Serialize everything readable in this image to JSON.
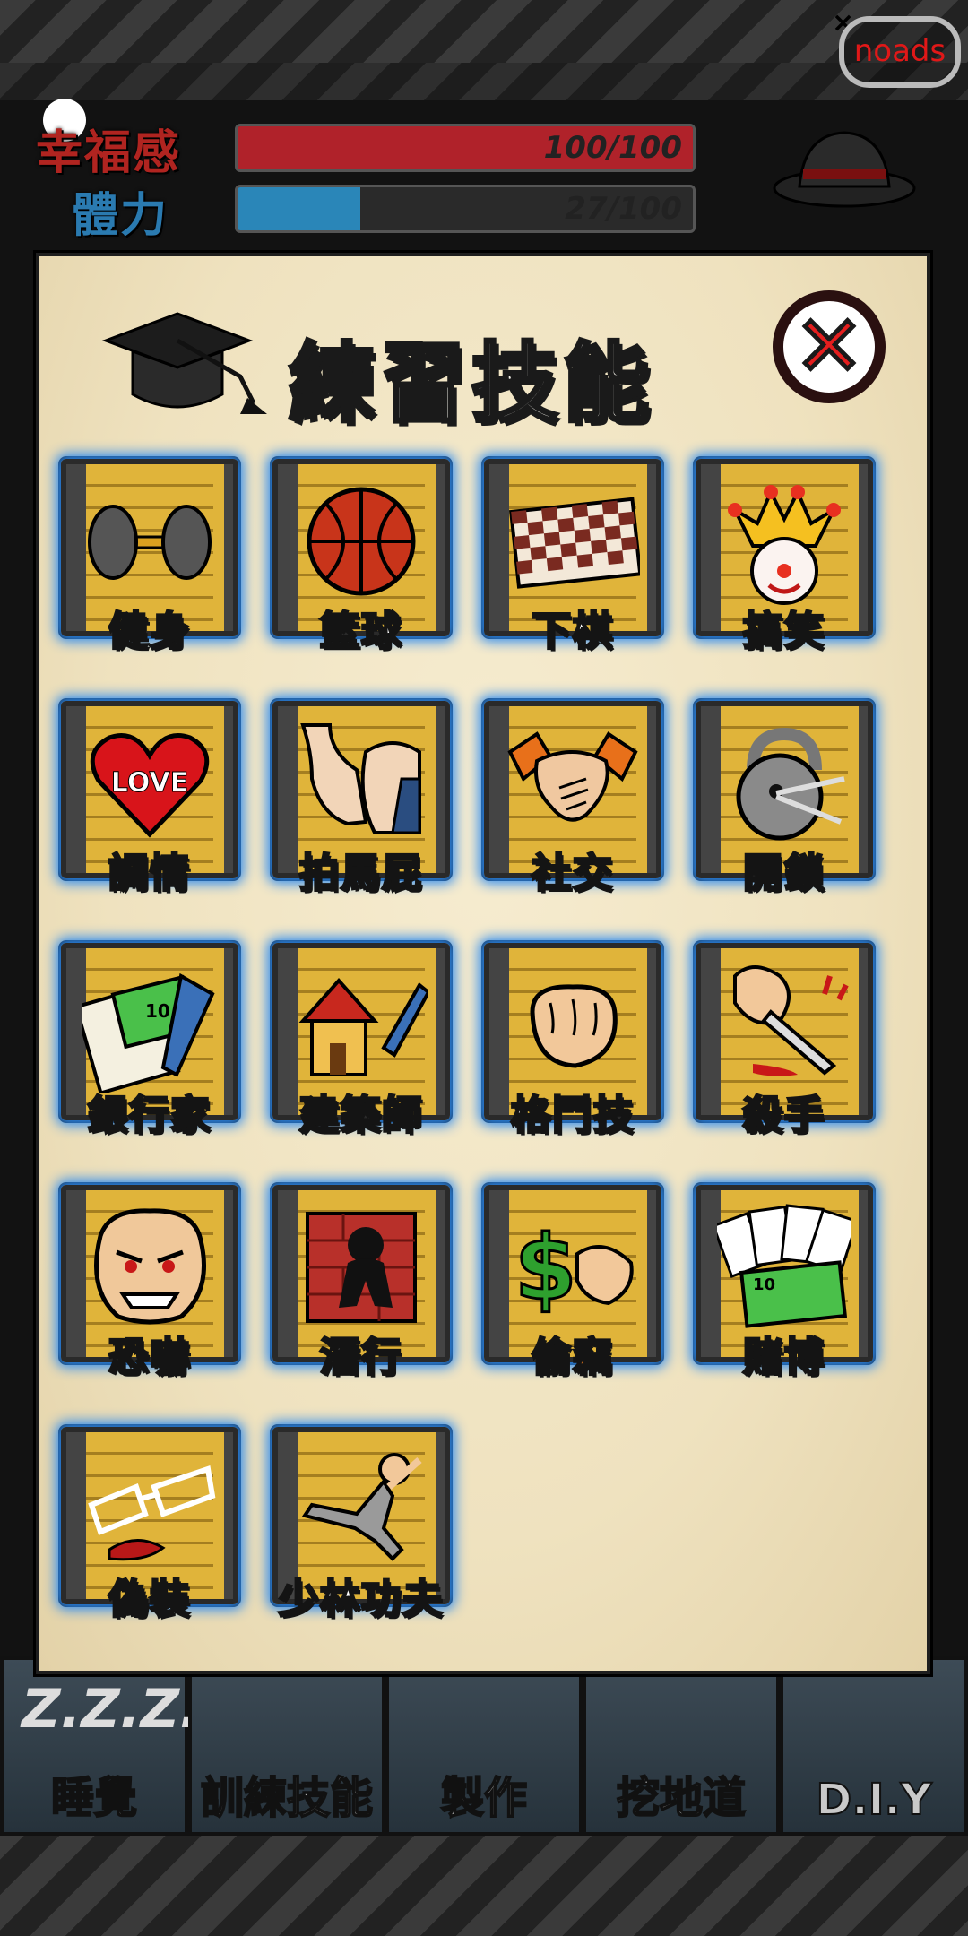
{
  "hud": {
    "stats": [
      {
        "label": "幸福感",
        "value": "100/100",
        "fill_ratio": 1.0,
        "color": "#b0222a"
      },
      {
        "label": "體力",
        "value": "27/100",
        "fill_ratio": 0.27,
        "color": "#2a86b8"
      }
    ],
    "noads_label": "noads",
    "close_glyph": "×"
  },
  "dialog": {
    "title": "練習技能",
    "close_glyph": "✕",
    "skills": [
      {
        "label": "健身",
        "icon": "dumbbell-icon"
      },
      {
        "label": "籃球",
        "icon": "basketball-icon"
      },
      {
        "label": "下棋",
        "icon": "chessboard-icon"
      },
      {
        "label": "搞笑",
        "icon": "clown-icon"
      },
      {
        "label": "調情",
        "icon": "heart-icon",
        "icon_text": "LOVE"
      },
      {
        "label": "拍馬屁",
        "icon": "kiss-butt-icon"
      },
      {
        "label": "社交",
        "icon": "handshake-icon"
      },
      {
        "label": "開鎖",
        "icon": "lock-pick-icon"
      },
      {
        "label": "銀行家",
        "icon": "money-notebook-icon",
        "icon_text": "10"
      },
      {
        "label": "建築師",
        "icon": "house-pencil-icon"
      },
      {
        "label": "格鬥技",
        "icon": "fist-icon"
      },
      {
        "label": "殺手",
        "icon": "knife-hand-icon"
      },
      {
        "label": "恐嚇",
        "icon": "angry-face-icon"
      },
      {
        "label": "潛行",
        "icon": "ninja-icon"
      },
      {
        "label": "偷竊",
        "icon": "steal-money-icon",
        "highlight": true
      },
      {
        "label": "賭博",
        "icon": "cards-money-icon",
        "icon_text": "10"
      },
      {
        "label": "偽裝",
        "icon": "disguise-glasses-icon"
      },
      {
        "label": "少林功夫",
        "icon": "kungfu-kick-icon"
      }
    ]
  },
  "bottom_bar": [
    {
      "label": "睡覺",
      "icon_text": "Z.Z.Z..."
    },
    {
      "label": "訓練技能",
      "icon": "grad-cap-icon"
    },
    {
      "label": "製作",
      "icon": "tools-icon"
    },
    {
      "label": "挖地道",
      "icon": "dig-icon"
    },
    {
      "label": "D.I.Y",
      "icon": "book-icon"
    }
  ]
}
